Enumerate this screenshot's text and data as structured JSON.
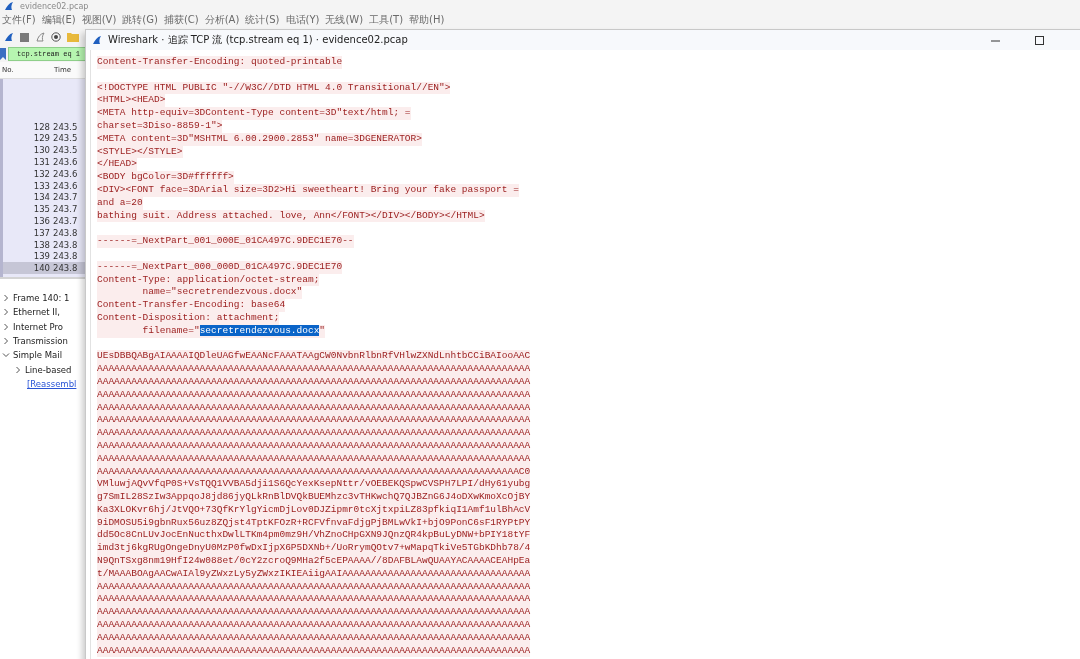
{
  "main_window": {
    "title": "evidence02.pcap",
    "menu": [
      "文件(F)",
      "编辑(E)",
      "视图(V)",
      "跳转(G)",
      "捕获(C)",
      "分析(A)",
      "统计(S)",
      "电话(Y)",
      "无线(W)",
      "工具(T)",
      "帮助(H)"
    ],
    "filter": "tcp.stream eq 1",
    "packet_list": {
      "columns": [
        "No.",
        "Time"
      ],
      "rows": [
        {
          "no": "128",
          "time": "243.5",
          "selected": false
        },
        {
          "no": "129",
          "time": "243.5",
          "selected": false
        },
        {
          "no": "130",
          "time": "243.5",
          "selected": false
        },
        {
          "no": "131",
          "time": "243.6",
          "selected": false
        },
        {
          "no": "132",
          "time": "243.6",
          "selected": false
        },
        {
          "no": "133",
          "time": "243.6",
          "selected": false
        },
        {
          "no": "134",
          "time": "243.7",
          "selected": false
        },
        {
          "no": "135",
          "time": "243.7",
          "selected": false
        },
        {
          "no": "136",
          "time": "243.7",
          "selected": false
        },
        {
          "no": "137",
          "time": "243.8",
          "selected": false
        },
        {
          "no": "138",
          "time": "243.8",
          "selected": false
        },
        {
          "no": "139",
          "time": "243.8",
          "selected": false
        },
        {
          "no": "140",
          "time": "243.8",
          "selected": true
        }
      ]
    },
    "details": [
      {
        "kind": "node",
        "label": "Frame 140: 1",
        "expanded": false
      },
      {
        "kind": "node",
        "label": "Ethernet II,",
        "expanded": false
      },
      {
        "kind": "node",
        "label": "Internet Pro",
        "expanded": false
      },
      {
        "kind": "node",
        "label": "Transmission",
        "expanded": false
      },
      {
        "kind": "node",
        "label": "Simple Mail",
        "expanded": true,
        "children": [
          {
            "kind": "node",
            "label": "Line-based",
            "expanded": false
          },
          {
            "kind": "link",
            "label": "[Reassembl"
          }
        ]
      }
    ]
  },
  "dialog": {
    "title": "Wireshark · 追踪 TCP 流 (tcp.stream eq 1) · evidence02.pcap",
    "blocks": [
      [
        "Content-Transfer-Encoding: quoted-printable"
      ],
      [
        "<!DOCTYPE HTML PUBLIC \"-//W3C//DTD HTML 4.0 Transitional//EN\">",
        "<HTML><HEAD>",
        "<META http-equiv=3DContent-Type content=3D\"text/html; =",
        "charset=3Diso-8859-1\">",
        "<META content=3D\"MSHTML 6.00.2900.2853\" name=3DGENERATOR>",
        "<STYLE></STYLE>",
        "</HEAD>",
        "<BODY bgColor=3D#ffffff>",
        "<DIV><FONT face=3DArial size=3D2>Hi sweetheart! Bring your fake passport =",
        "and a=20",
        "bathing suit. Address attached. love, Ann</FONT></DIV></BODY></HTML>"
      ],
      [
        "------=_NextPart_001_000E_01CA497C.9DEC1E70--"
      ],
      [
        "------=_NextPart_000_000D_01CA497C.9DEC1E70",
        "Content-Type: application/octet-stream;",
        "        name=\"secretrendezvous.docx\"",
        "Content-Transfer-Encoding: base64",
        "Content-Disposition: attachment;",
        {
          "segments": [
            {
              "text": "        filename=\"",
              "selected": false
            },
            {
              "text": "secretrendezvous.docx",
              "selected": true
            },
            {
              "text": "\"",
              "selected": false
            }
          ]
        }
      ],
      [
        "UEsDBBQABgAIAAAAIQDleUAGfwEAANcFAAATAAgCW0NvbnRlbnRfVHlwZXNdLnhtbCCiBAIooAAC",
        "AAAAAAAAAAAAAAAAAAAAAAAAAAAAAAAAAAAAAAAAAAAAAAAAAAAAAAAAAAAAAAAAAAAAAAAAAAAA",
        "AAAAAAAAAAAAAAAAAAAAAAAAAAAAAAAAAAAAAAAAAAAAAAAAAAAAAAAAAAAAAAAAAAAAAAAAAAAA",
        "AAAAAAAAAAAAAAAAAAAAAAAAAAAAAAAAAAAAAAAAAAAAAAAAAAAAAAAAAAAAAAAAAAAAAAAAAAAA",
        "AAAAAAAAAAAAAAAAAAAAAAAAAAAAAAAAAAAAAAAAAAAAAAAAAAAAAAAAAAAAAAAAAAAAAAAAAAAA",
        "AAAAAAAAAAAAAAAAAAAAAAAAAAAAAAAAAAAAAAAAAAAAAAAAAAAAAAAAAAAAAAAAAAAAAAAAAAAA",
        "AAAAAAAAAAAAAAAAAAAAAAAAAAAAAAAAAAAAAAAAAAAAAAAAAAAAAAAAAAAAAAAAAAAAAAAAAAAA",
        "AAAAAAAAAAAAAAAAAAAAAAAAAAAAAAAAAAAAAAAAAAAAAAAAAAAAAAAAAAAAAAAAAAAAAAAAAAAA",
        "AAAAAAAAAAAAAAAAAAAAAAAAAAAAAAAAAAAAAAAAAAAAAAAAAAAAAAAAAAAAAAAAAAAAAAAAAAAA",
        "AAAAAAAAAAAAAAAAAAAAAAAAAAAAAAAAAAAAAAAAAAAAAAAAAAAAAAAAAAAAAAAAAAAAAAAAAAC0",
        "VMluwjAQvVfqP0S+VsTQQ1VVBA5dji1S6QcYexKsepNttr/vOEBEKQSpwCVSPH7LPI/dHy61yubg",
        "g7SmIL28SzIw3AppqoJ8jd86jyQLkRnBlDVQkBUEMhzc3vTHKwchQ7QJBZnG6J4oDXwKmoXcOjBY",
        "Ka3XLOKvr6hj/JtVQO+73QfKrYlgYicmDjLov0DJZipmr0tcXjtxpiLZ83pfkiqI1Amf1ulBhAcV",
        "9iDMOSU5i9gbnRux56uz8ZQjst4TptKFOzR+RCFVfnvaFdjgPjBMLwVkI+bjO9PonC6sF1RYPtPY",
        "dd5Oc8CnLUvJocEnNucthxDwlLTKm4pm0mz9H/VhZnoCHpGXN9JQnzQR4kpBuLyDNW+bPIY18tYF",
        "imd3tj6kgRUgOngeDnyU0MzP0fwDxIjpX6P5DXNb+/UoRrymQOtv7+wMapqTkiVe5TGbKDhb78/4",
        "N9QnTSxg8nm19HfI24w088et/0cY2zcroQ9MHa2f5cEPAAAA//8DAFBLAwQUAAYACAAAACEAHpEa",
        "t/MAAABOAgAACwAIAl9yZWxzLy5yZWxzIKIEAiigAAIAAAAAAAAAAAAAAAAAAAAAAAAAAAAAAAAA",
        "AAAAAAAAAAAAAAAAAAAAAAAAAAAAAAAAAAAAAAAAAAAAAAAAAAAAAAAAAAAAAAAAAAAAAAAAAAAA",
        "AAAAAAAAAAAAAAAAAAAAAAAAAAAAAAAAAAAAAAAAAAAAAAAAAAAAAAAAAAAAAAAAAAAAAAAAAAAA",
        "AAAAAAAAAAAAAAAAAAAAAAAAAAAAAAAAAAAAAAAAAAAAAAAAAAAAAAAAAAAAAAAAAAAAAAAAAAAA",
        "AAAAAAAAAAAAAAAAAAAAAAAAAAAAAAAAAAAAAAAAAAAAAAAAAAAAAAAAAAAAAAAAAAAAAAAAAAAA",
        "AAAAAAAAAAAAAAAAAAAAAAAAAAAAAAAAAAAAAAAAAAAAAAAAAAAAAAAAAAAAAAAAAAAAAAAAAAAA",
        "AAAAAAAAAAAAAAAAAAAAAAAAAAAAAAAAAAAAAAAAAAAAAAAAAAAAAAAAAAAAAAAAAAAAAAAAAAAA"
      ]
    ]
  }
}
